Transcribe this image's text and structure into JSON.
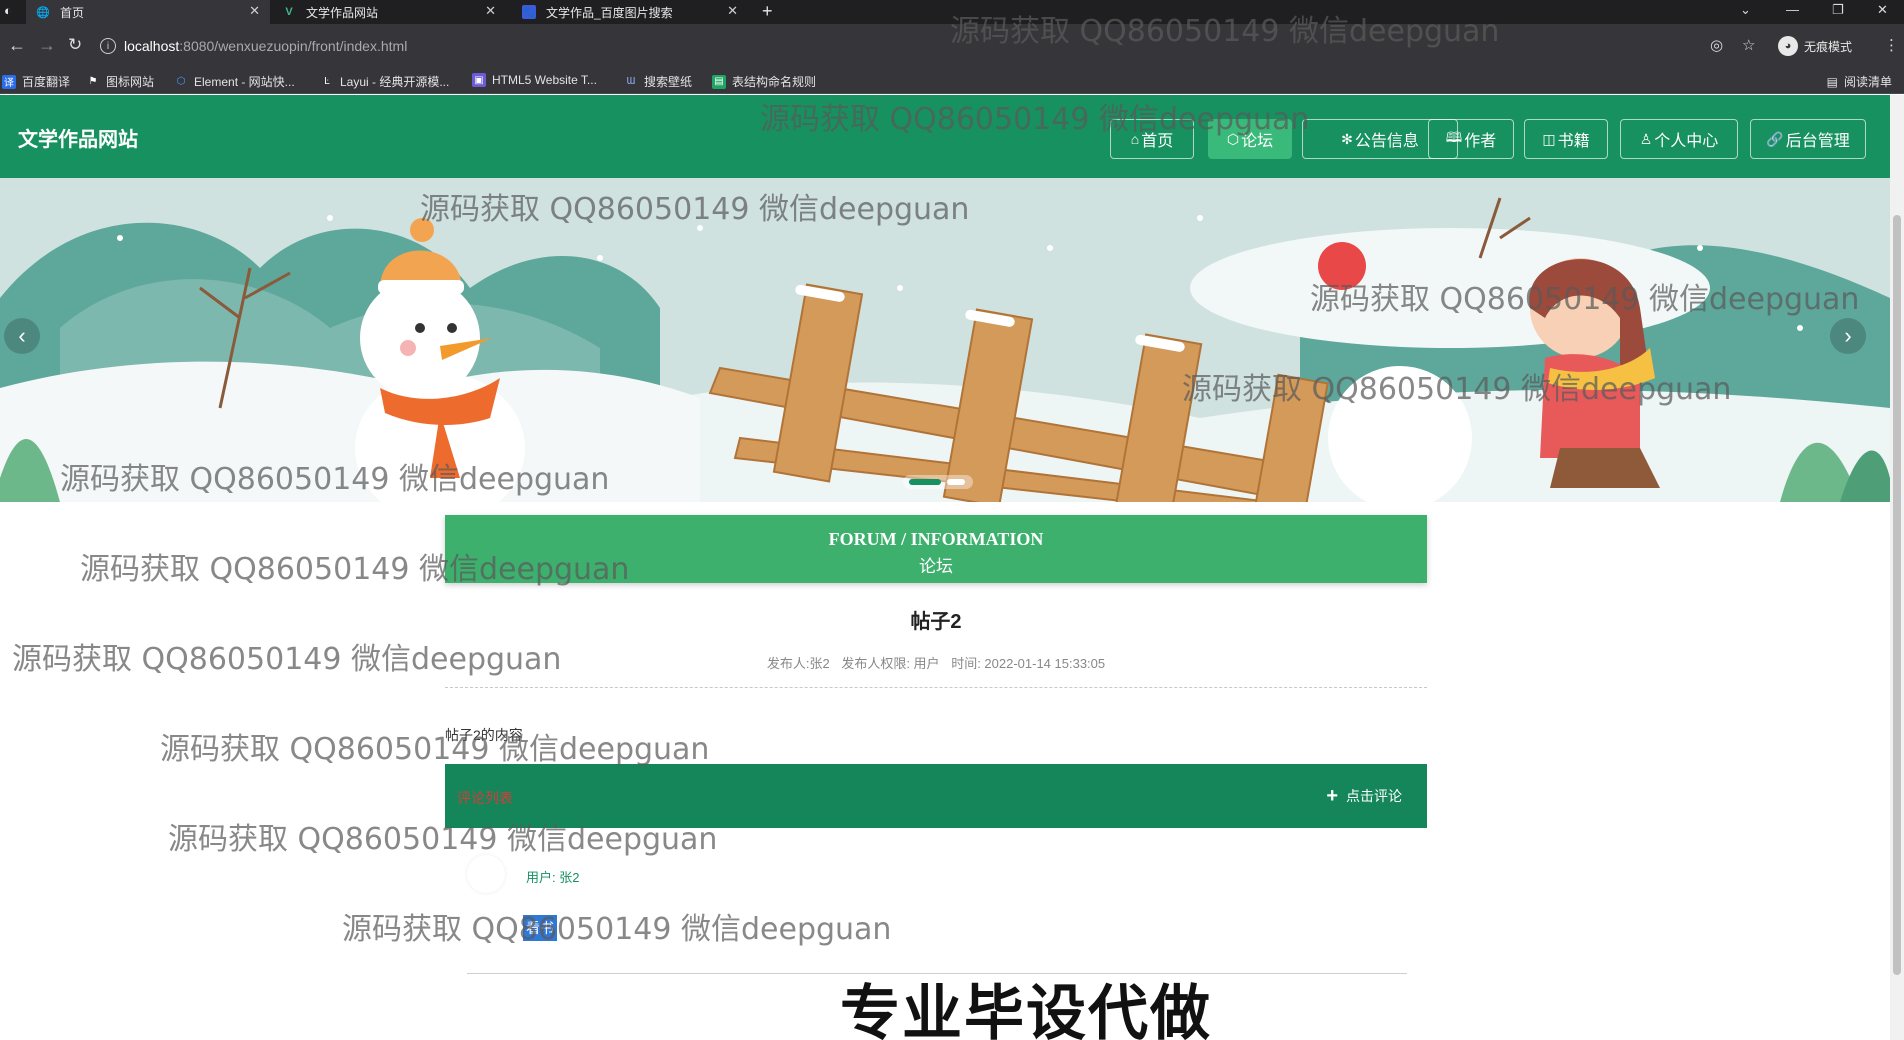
{
  "browser": {
    "tabs": [
      {
        "label": "首页",
        "icon": "globe-icon"
      },
      {
        "label": "文学作品网站",
        "icon": "vue-icon"
      },
      {
        "label": "文学作品_百度图片搜索",
        "icon": "baidu-paw-icon"
      }
    ],
    "new_tab": "+",
    "url_host": "localhost",
    "url_path": ":8080/wenxuezuopin/front/index.html",
    "incognito_label": "无痕模式",
    "bookmarks": [
      "百度翻译",
      "图标网站",
      "Element - 网站快...",
      "Layui - 经典开源模...",
      "HTML5 Website T...",
      "搜索壁纸",
      "表结构命名规则"
    ],
    "reading_list": "阅读清单"
  },
  "site": {
    "title": "文学作品网站",
    "nav": [
      {
        "icon": "⌂",
        "label": "首页"
      },
      {
        "icon": "⬡",
        "label": "论坛"
      },
      {
        "icon": "✻",
        "label": "公告信息"
      },
      {
        "icon": "🕮",
        "label": "作者"
      },
      {
        "icon": "◫",
        "label": "书籍"
      },
      {
        "icon": "♙",
        "label": "个人中心"
      },
      {
        "icon": "🔗",
        "label": "后台管理"
      }
    ],
    "active_nav": "论坛"
  },
  "carousel": {
    "prev": "‹",
    "next": "›",
    "slides": 2,
    "active_slide": 1
  },
  "forum": {
    "header_en": "FORUM / INFORMATION",
    "header_cn": "论坛",
    "post_title": "帖子2",
    "meta_author": "发布人:张2",
    "meta_role": "发布人权限: 用户",
    "meta_time": "时间: 2022-01-14 15:33:05",
    "post_content": "帖子2的内容",
    "comments_label": "评论列表",
    "add_comment": "点击评论",
    "comment_user": "用户: 张2",
    "comment_text": "看书"
  },
  "footer_text": "专业毕设代做",
  "watermark_text": "源码获取 QQ86050149 微信deepguan",
  "colors": {
    "primary": "#16915f",
    "header_green": "#3db06e",
    "comment_bar": "#148659"
  }
}
